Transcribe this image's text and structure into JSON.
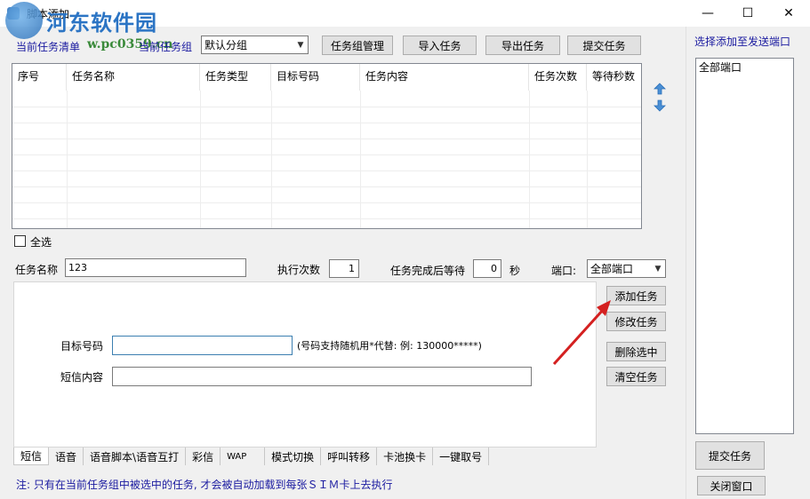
{
  "window": {
    "title": "脚本添加",
    "watermark_text": "河东软件园",
    "watermark_url": "w.pc0359.cn",
    "minimize": "—",
    "maximize": "☐",
    "close": "✕"
  },
  "toolbar": {
    "current_list_label": "当前任务清单",
    "current_group_label": "当前任务组",
    "group_select_value": "默认分组",
    "btn_manage": "任务组管理",
    "btn_import": "导入任务",
    "btn_export": "导出任务",
    "btn_submit": "提交任务"
  },
  "table": {
    "columns": [
      "序号",
      "任务名称",
      "任务类型",
      "目标号码",
      "任务内容",
      "任务次数",
      "等待秒数"
    ],
    "rows": []
  },
  "select_all_label": "全选",
  "task_form": {
    "name_label": "任务名称",
    "name_value": "123",
    "exec_count_label": "执行次数",
    "exec_count_value": "1",
    "wait_label": "任务完成后等待",
    "wait_value": "0",
    "seconds_unit": "秒",
    "port_label": "端口:",
    "port_value": "全部端口"
  },
  "sms": {
    "target_label": "目标号码",
    "target_value": "",
    "target_hint": "(号码支持随机用*代替: 例: 130000*****)",
    "content_label": "短信内容",
    "content_value": ""
  },
  "actions": {
    "add": "添加任务",
    "modify": "修改任务",
    "delete": "删除选中",
    "clear": "清空任务"
  },
  "tabs": [
    "短信",
    "语音",
    "语音脚本\\语音互打",
    "彩信",
    "WAP",
    "模式切换",
    "呼叫转移",
    "卡池换卡",
    "一键取号"
  ],
  "right_panel": {
    "title": "选择添加至发送端口",
    "ports": [
      "全部端口"
    ],
    "submit": "提交任务",
    "close": "关闭窗口"
  },
  "note": "注: 只有在当前任务组中被选中的任务, 才会被自动加载到每张ＳＩＭ卡上去执行",
  "colors": {
    "accent_text": "#1a1aa0",
    "annotation_arrow": "#d42020"
  }
}
